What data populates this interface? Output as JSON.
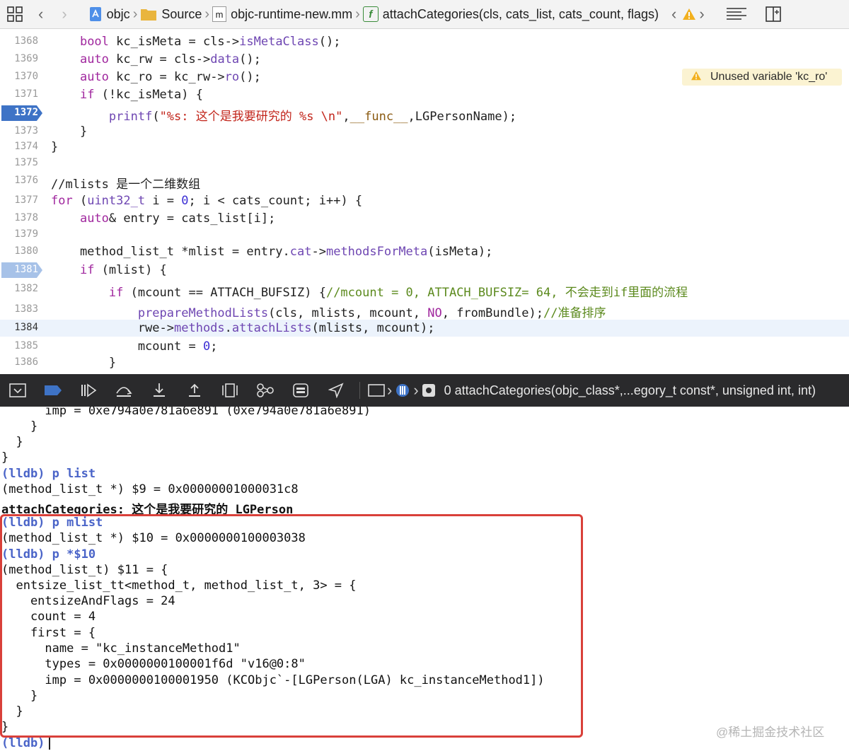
{
  "nav": {
    "crumbs": [
      "objc",
      "Source",
      "objc-runtime-new.mm",
      "attachCategories(cls, cats_list, cats_count, flags)"
    ],
    "file_badge": "m",
    "func_badge": "f"
  },
  "editor": {
    "warning": "Unused variable 'kc_ro'",
    "lines": [
      {
        "n": "1368",
        "code": "    bool kc_isMeta = cls->isMetaClass();"
      },
      {
        "n": "1369",
        "code": "    auto kc_rw = cls->data();"
      },
      {
        "n": "1370",
        "code": "    auto kc_ro = kc_rw->ro();"
      },
      {
        "n": "1371",
        "code": "    if (!kc_isMeta) {"
      },
      {
        "n": "1372",
        "code": "        printf(\"%s: 这个是我要研究的 %s \\n\",__func__,LGPersonName);"
      },
      {
        "n": "1373",
        "code": "    }"
      },
      {
        "n": "1374",
        "code": "}"
      },
      {
        "n": "1375",
        "code": ""
      },
      {
        "n": "1376",
        "code": "//mlists 是一个二维数组"
      },
      {
        "n": "1377",
        "code": "for (uint32_t i = 0; i < cats_count; i++) {"
      },
      {
        "n": "1378",
        "code": "    auto& entry = cats_list[i];"
      },
      {
        "n": "1379",
        "code": ""
      },
      {
        "n": "1380",
        "code": "    method_list_t *mlist = entry.cat->methodsForMeta(isMeta);"
      },
      {
        "n": "1381",
        "code": "    if (mlist) {"
      },
      {
        "n": "1382",
        "code": "        if (mcount == ATTACH_BUFSIZ) {//mcount = 0, ATTACH_BUFSIZ= 64, 不会走到if里面的流程"
      },
      {
        "n": "1383",
        "code": "            prepareMethodLists(cls, mlists, mcount, NO, fromBundle);//准备排序"
      },
      {
        "n": "1384",
        "code": "            rwe->methods.attachLists(mlists, mcount);"
      },
      {
        "n": "1385",
        "code": "            mcount = 0;"
      },
      {
        "n": "1386",
        "code": "        }"
      }
    ]
  },
  "debugbar": {
    "frame": "0 attachCategories(objc_class*,...egory_t const*, unsigned int, int)"
  },
  "console": {
    "lines": [
      "      imp = 0xe794a0e781a6e891 (0xe794a0e781a6e891)",
      "    }",
      "  }",
      "}",
      "(lldb) p list",
      "(method_list_t *) $9 = 0x00000001000031c8",
      "attachCategories: 这个是我要研究的 LGPerson",
      "(lldb) p mlist",
      "(method_list_t *) $10 = 0x0000000100003038",
      "(lldb) p *$10",
      "(method_list_t) $11 = {",
      "  entsize_list_tt<method_t, method_list_t, 3> = {",
      "    entsizeAndFlags = 24",
      "    count = 4",
      "    first = {",
      "      name = \"kc_instanceMethod1\"",
      "      types = 0x0000000100001f6d \"v16@0:8\"",
      "      imp = 0x0000000100001950 (KCObjc`-[LGPerson(LGA) kc_instanceMethod1])",
      "    }",
      "  }",
      "}",
      "(lldb)"
    ],
    "watermark": "@稀土掘金技术社区"
  },
  "colors": {
    "breakpoint": "#3e73c6",
    "highlight_border": "#d9403a",
    "debugbar_bg": "#2a2a2c",
    "warning_bg": "#fbf3d2"
  }
}
